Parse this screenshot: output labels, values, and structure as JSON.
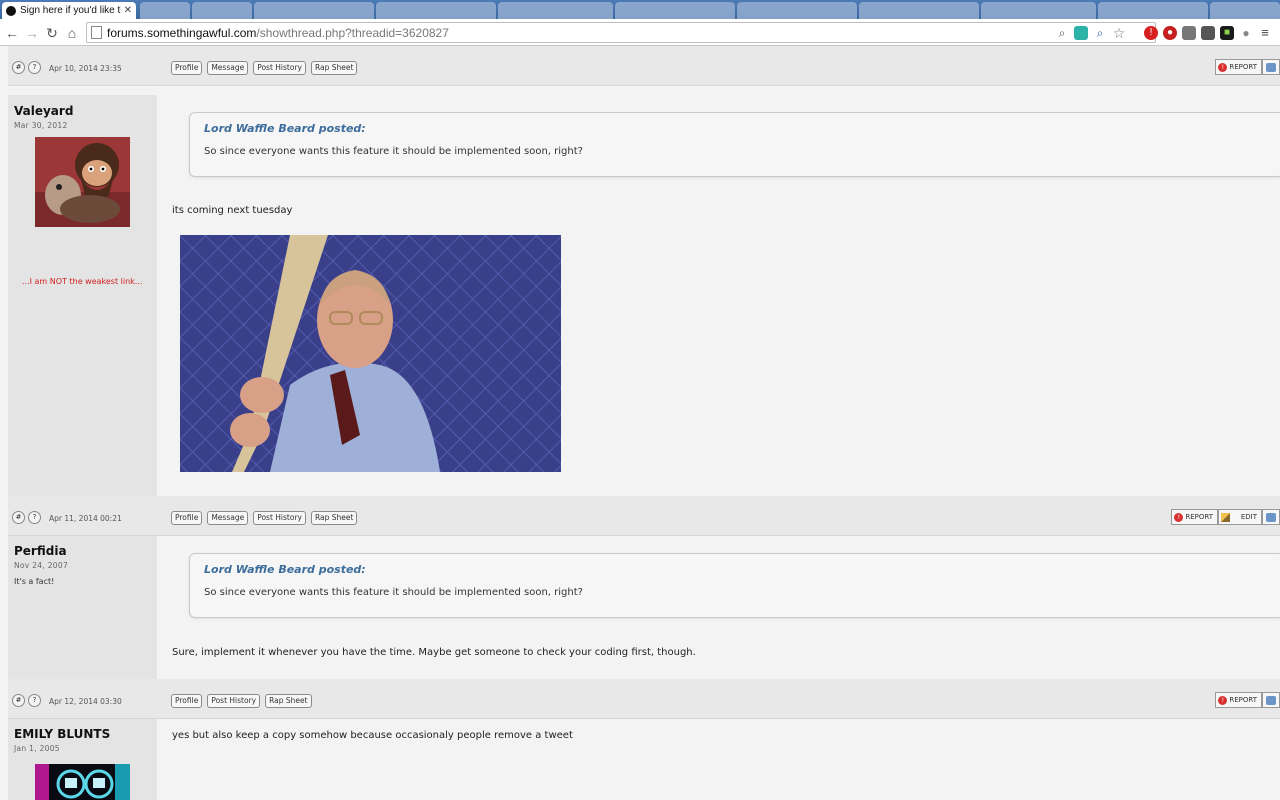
{
  "browser": {
    "active_tab_title": "Sign here if you'd like the",
    "background_tabs": [
      "",
      "",
      "",
      "",
      "",
      "",
      "",
      "",
      "",
      "",
      "",
      ""
    ],
    "url_host": "forums.somethingawful.com",
    "url_path": "/showthread.php?threadid=3620827",
    "toolbar_icons": [
      "search-icon",
      "shade-icon",
      "zoom-icon",
      "star-icon",
      "opera-icon",
      "adblock-icon",
      "extension-icon",
      "extension-icon",
      "green-extension-icon",
      "balloon-icon",
      "menu-icon"
    ]
  },
  "posts": [
    {
      "footer": {
        "date": "Apr 10, 2014 23:35",
        "buttons": [
          "Profile",
          "Message",
          "Post History",
          "Rap Sheet"
        ],
        "right": [
          "REPORT"
        ]
      },
      "username": "Valeyard",
      "regdate": "Mar 30, 2012",
      "usertitle": "...I am NOT the weakest link...",
      "quote_author": "Lord Waffle Beard posted:",
      "quote_text": "So since everyone wants this feature it should be implemented soon, right?",
      "text": "its coming next tuesday"
    },
    {
      "footer": {
        "date": "Apr 11, 2014 00:21",
        "buttons": [
          "Profile",
          "Message",
          "Post History",
          "Rap Sheet"
        ],
        "right": [
          "REPORT",
          "EDIT"
        ]
      },
      "username": "Perfidia",
      "regdate": "Nov 24, 2007",
      "usertitle": "It's a fact!",
      "quote_author": "Lord Waffle Beard posted:",
      "quote_text": "So since everyone wants this feature it should be implemented soon, right?",
      "text": "Sure, implement it whenever you have the time. Maybe get someone to check your coding first, though."
    },
    {
      "footer": {
        "date": "Apr 12, 2014 03:30",
        "buttons": [
          "Profile",
          "Post History",
          "Rap Sheet"
        ],
        "right": [
          "REPORT"
        ]
      },
      "username": "EMILY BLUNTS",
      "regdate": "Jan 1, 2005",
      "text": "yes but also keep a copy somehow because occasionaly people remove a tweet"
    }
  ],
  "colors": {
    "quote_author": "#3d6d9c",
    "usertitle_red": "#d02020",
    "report_red": "#d93030",
    "tabstrip": "#3a679f"
  }
}
